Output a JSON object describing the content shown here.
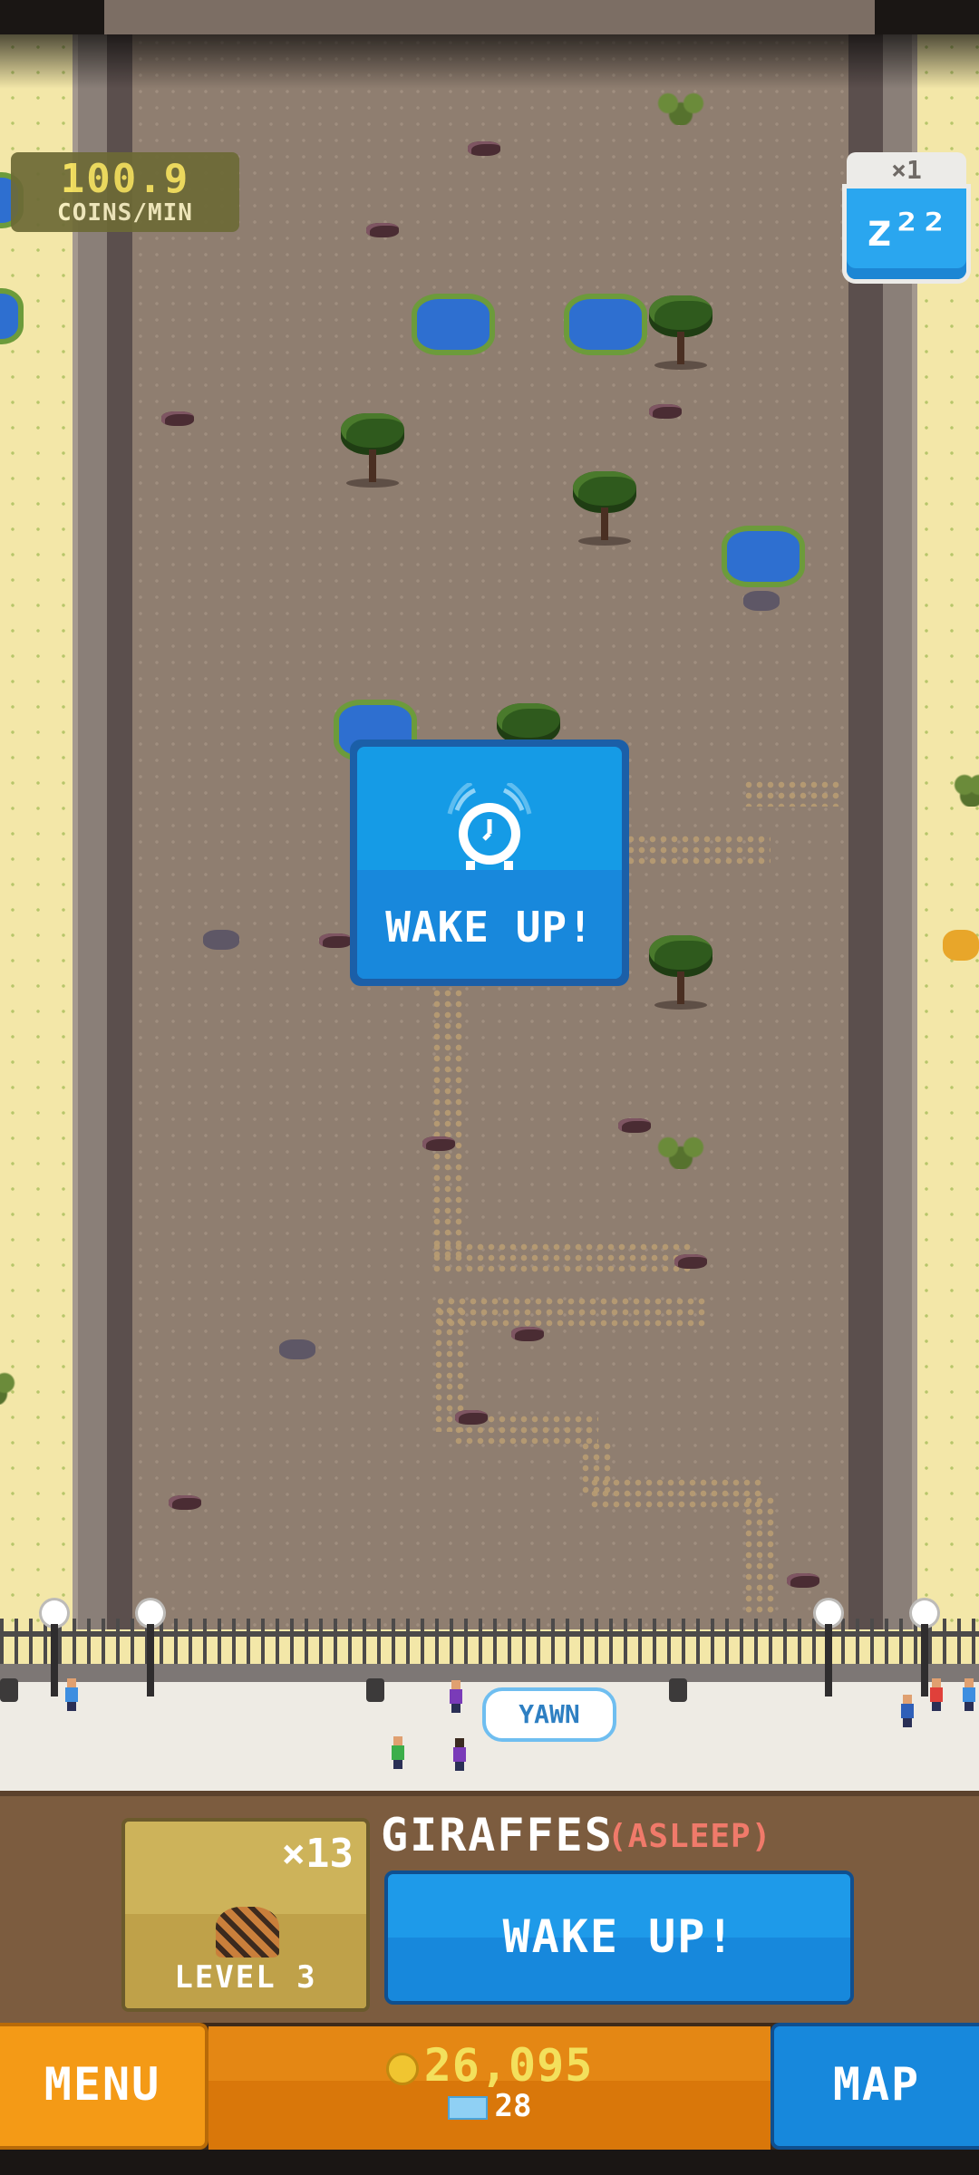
{
  "hud": {
    "rate_value": "100.9",
    "rate_unit": "COINS/MIN",
    "sleep_multiplier": "×1",
    "sleep_icon": "zzz-icon",
    "sleep_label": "z²²"
  },
  "popup": {
    "icon": "alarm-clock-icon",
    "label": "WAKE UP!"
  },
  "visitor_bubble": "YAWN",
  "enclosure_panel": {
    "count": "×13",
    "level": "LEVEL 3",
    "animal_name": "GIRAFFES",
    "animal_state": "(ASLEEP)",
    "wake_button": "WAKE UP!"
  },
  "bottom_bar": {
    "menu_label": "MENU",
    "coins": "26,095",
    "gems": "28",
    "map_label": "MAP"
  },
  "colors": {
    "accent_blue": "#1788dc",
    "accent_orange": "#f49a16",
    "coin_yellow": "#f3e05c",
    "state_red": "#f07a6a"
  }
}
